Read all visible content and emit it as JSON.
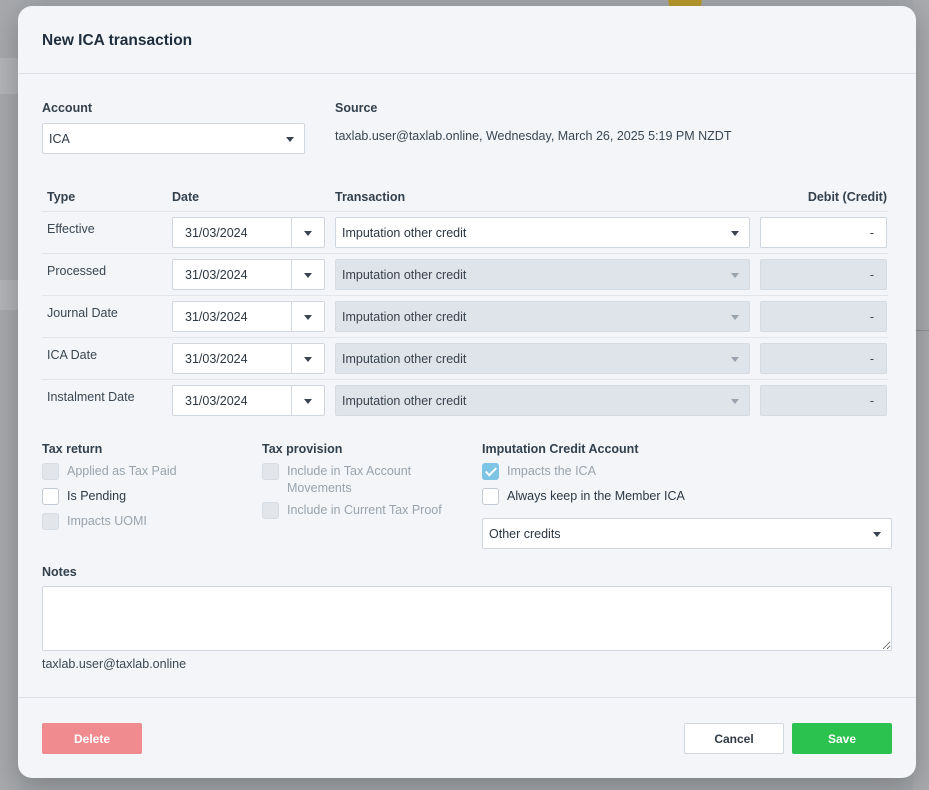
{
  "modal": {
    "title": "New ICA transaction",
    "account_label": "Account",
    "account_value": "ICA",
    "source_label": "Source",
    "source_value": "taxlab.user@taxlab.online, Wednesday, March 26, 2025 5:19 PM NZDT"
  },
  "table": {
    "headers": {
      "type": "Type",
      "date": "Date",
      "transaction": "Transaction",
      "amount": "Debit (Credit)"
    },
    "rows": [
      {
        "type": "Effective",
        "date": "31/03/2024",
        "transaction": "Imputation other credit",
        "amount": "-"
      },
      {
        "type": "Processed",
        "date": "31/03/2024",
        "transaction": "Imputation other credit",
        "amount": "-"
      },
      {
        "type": "Journal Date",
        "date": "31/03/2024",
        "transaction": "Imputation other credit",
        "amount": "-"
      },
      {
        "type": "ICA Date",
        "date": "31/03/2024",
        "transaction": "Imputation other credit",
        "amount": "-"
      },
      {
        "type": "Instalment Date",
        "date": "31/03/2024",
        "transaction": "Imputation other credit",
        "amount": "-"
      }
    ]
  },
  "tax_return": {
    "heading": "Tax return",
    "applied_as_tax_paid": "Applied as Tax Paid",
    "is_pending": "Is Pending",
    "impacts_uomi": "Impacts UOMI"
  },
  "tax_provision": {
    "heading": "Tax provision",
    "include_movements_line1": "Include in Tax Account",
    "include_movements_line2": "Movements",
    "include_proof": "Include in Current Tax Proof"
  },
  "ica": {
    "heading": "Imputation Credit Account",
    "impacts_ica": "Impacts the ICA",
    "always_keep": "Always keep in the Member ICA",
    "category_value": "Other credits"
  },
  "notes": {
    "label": "Notes",
    "value": "",
    "author": "taxlab.user@taxlab.online"
  },
  "footer": {
    "delete_label": "Delete",
    "cancel_label": "Cancel",
    "save_label": "Save"
  },
  "colors": {
    "save": "#2cc24f",
    "delete": "#f08c8f",
    "checked": "#7ec4e4"
  }
}
